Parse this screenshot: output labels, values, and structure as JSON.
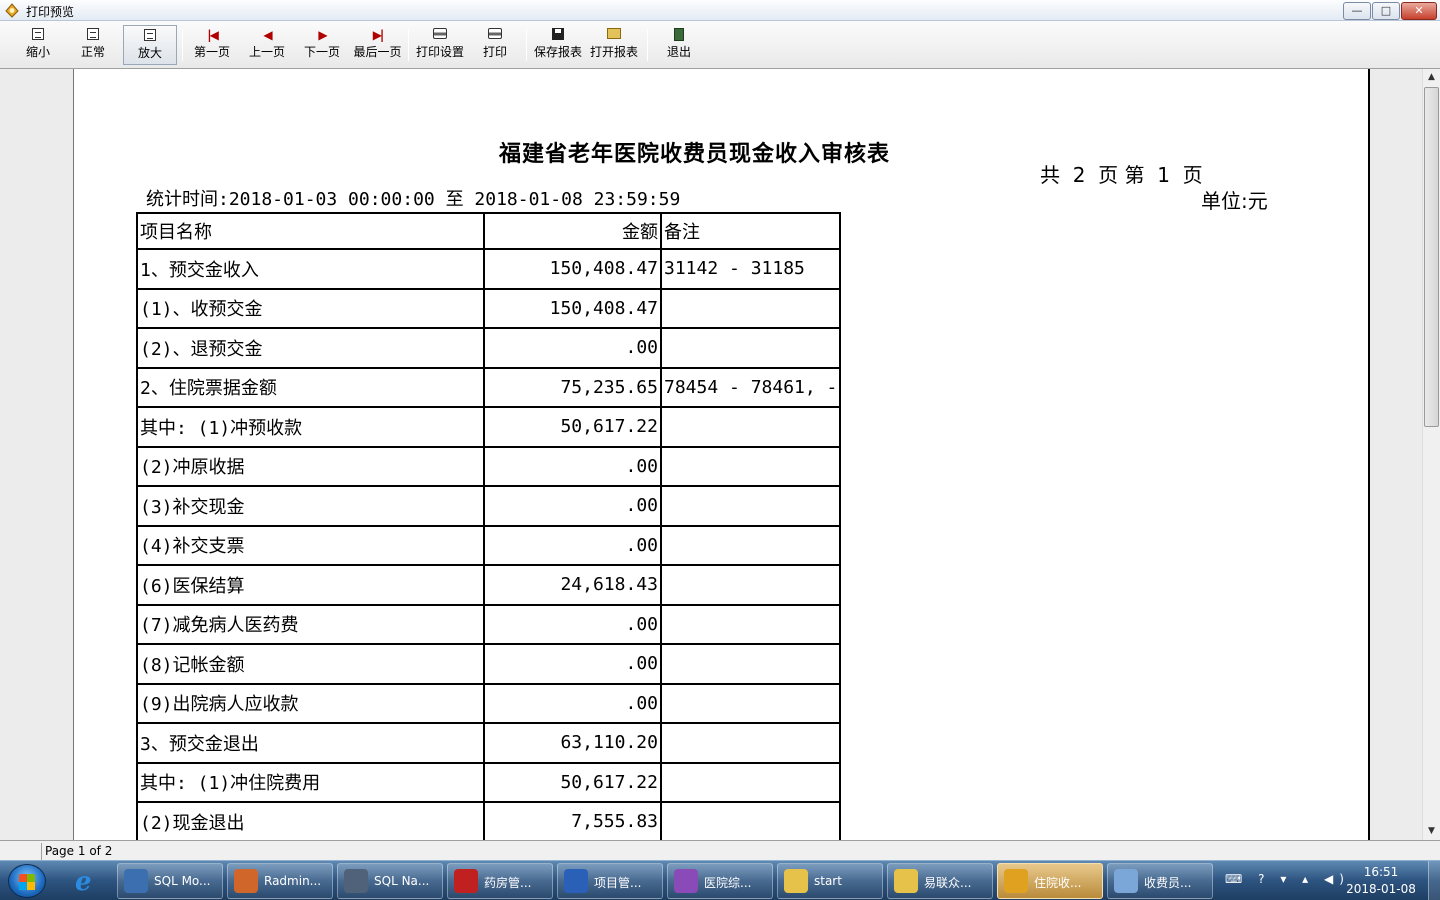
{
  "window": {
    "title": "打印预览",
    "controls": {
      "minimize": "—",
      "maximize": "□",
      "close": "✕"
    }
  },
  "toolbar": {
    "buttons": [
      {
        "label": "缩小",
        "icon": "zoom-out-page-icon"
      },
      {
        "label": "正常",
        "icon": "normal-view-page-icon"
      },
      {
        "label": "放大",
        "icon": "zoom-in-page-icon",
        "active": true
      },
      {
        "label": "第一页",
        "icon": "first-page-icon",
        "glyph": "|◀"
      },
      {
        "label": "上一页",
        "icon": "prev-page-icon",
        "glyph": "◀"
      },
      {
        "label": "下一页",
        "icon": "next-page-icon",
        "glyph": "▶"
      },
      {
        "label": "最后一页",
        "icon": "last-page-icon",
        "glyph": "▶|"
      },
      {
        "label": "打印设置",
        "icon": "print-setup-icon"
      },
      {
        "label": "打印",
        "icon": "printer-icon"
      },
      {
        "label": "保存报表",
        "icon": "save-disk-icon"
      },
      {
        "label": "打开报表",
        "icon": "open-folder-icon"
      },
      {
        "label": "退出",
        "icon": "exit-door-icon"
      }
    ]
  },
  "report": {
    "title": "福建省老年医院收费员现金收入审核表",
    "page_info": "共  2  页 第  1  页",
    "unit": "单位:元",
    "period": "统计时间:2018-01-03 00:00:00 至 2018-01-08 23:59:59",
    "columns": [
      "项目名称",
      "金额",
      "备注"
    ],
    "rows": [
      {
        "name": "1、预交金收入",
        "amount": "150,408.47",
        "note": "31142 - 31185",
        "indent": 1
      },
      {
        "name": "(1)、收预交金",
        "amount": "150,408.47",
        "note": "",
        "indent": 2
      },
      {
        "name": "(2)、退预交金",
        "amount": ".00",
        "note": "",
        "indent": 2
      },
      {
        "name": "2、住院票据金额",
        "amount": "75,235.65",
        "note": "78454 - 78461, -",
        "indent": 1
      },
      {
        "name": "其中: (1)冲预收款",
        "amount": "50,617.22",
        "note": "",
        "indent": 1
      },
      {
        "name": "(2)冲原收据",
        "amount": ".00",
        "note": "",
        "indent": 3
      },
      {
        "name": "(3)补交现金",
        "amount": ".00",
        "note": "",
        "indent": 3
      },
      {
        "name": "(4)补交支票",
        "amount": ".00",
        "note": "",
        "indent": 3
      },
      {
        "name": "(6)医保结算",
        "amount": "24,618.43",
        "note": "",
        "indent": 3
      },
      {
        "name": "(7)减免病人医药费",
        "amount": ".00",
        "note": "",
        "indent": 3
      },
      {
        "name": "(8)记帐金额",
        "amount": ".00",
        "note": "",
        "indent": 3
      },
      {
        "name": "(9)出院病人应收款",
        "amount": ".00",
        "note": "",
        "indent": 3
      },
      {
        "name": "3、预交金退出",
        "amount": "63,110.20",
        "note": "",
        "indent": 1
      },
      {
        "name": "其中: (1)冲住院费用",
        "amount": "50,617.22",
        "note": "",
        "indent": 1
      },
      {
        "name": "(2)现金退出",
        "amount": "7,555.83",
        "note": "",
        "indent": 3
      }
    ]
  },
  "status": {
    "page_text": "Page 1 of 2"
  },
  "taskbar": {
    "items": [
      {
        "label": "SQL Mo...",
        "icon": "sql-monitor-icon",
        "color": "#3b6fb0"
      },
      {
        "label": "Radmin...",
        "icon": "radmin-icon",
        "color": "#d0662a"
      },
      {
        "label": "SQL Na...",
        "icon": "sql-navigator-icon",
        "color": "#50627a"
      },
      {
        "label": "药房管...",
        "icon": "pharmacy-app-icon",
        "color": "#c02020"
      },
      {
        "label": "项目管...",
        "icon": "project-app-icon",
        "color": "#2a60b8"
      },
      {
        "label": "医院综...",
        "icon": "hospital-app-icon",
        "color": "#8a4ab8"
      },
      {
        "label": "start",
        "icon": "folder-icon",
        "color": "#e6c24a"
      },
      {
        "label": "易联众...",
        "icon": "folder-icon",
        "color": "#e6c24a"
      },
      {
        "label": "住院收...",
        "icon": "inpatient-app-icon",
        "color": "#e0a020",
        "active": true
      },
      {
        "label": "收费员...",
        "icon": "paint-app-icon",
        "color": "#7aa6d8"
      }
    ],
    "tray_icons": "⌨ ? ▾ ▴ ◀)",
    "clock_time": "16:51",
    "clock_date": "2018-01-08"
  }
}
